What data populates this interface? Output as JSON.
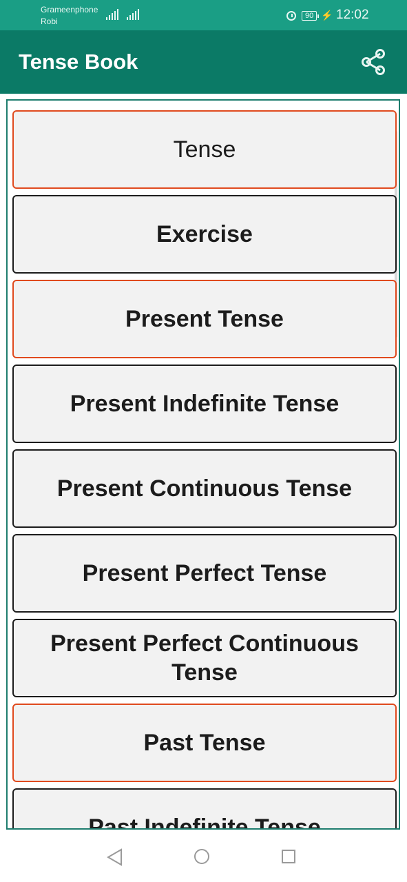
{
  "status_bar": {
    "carrier_1": "Grameenphone",
    "carrier_2": "Robi",
    "battery": "90",
    "time": "12:02"
  },
  "app_bar": {
    "title": "Tense Book",
    "share_icon": "share-icon"
  },
  "items": [
    "Tense",
    "Exercise",
    "Present Tense",
    "Present Indefinite Tense",
    "Present Continuous Tense",
    "Present Perfect Tense",
    "Present Perfect Continuous Tense",
    "Past Tense",
    "Past Indefinite Tense"
  ],
  "colors": {
    "status_bar": "#1a9e85",
    "app_bar": "#0b7a66",
    "accent_border": "#e04a1e",
    "item_bg": "#f2f2f2"
  }
}
